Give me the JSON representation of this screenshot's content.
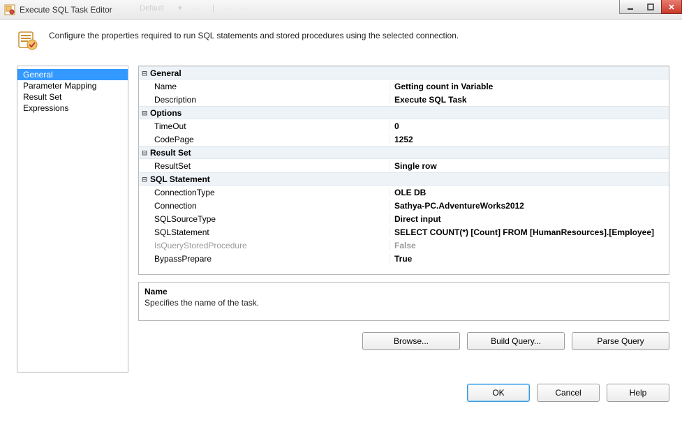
{
  "window": {
    "title": "Execute SQL Task Editor"
  },
  "header": {
    "description": "Configure the properties required to run SQL statements and stored procedures using the selected connection."
  },
  "nav": {
    "items": [
      {
        "label": "General",
        "selected": true
      },
      {
        "label": "Parameter Mapping",
        "selected": false
      },
      {
        "label": "Result Set",
        "selected": false
      },
      {
        "label": "Expressions",
        "selected": false
      }
    ]
  },
  "property_grid": {
    "categories": [
      {
        "name": "General",
        "rows": [
          {
            "key": "Name",
            "value": "Getting count in Variable"
          },
          {
            "key": "Description",
            "value": "Execute SQL Task"
          }
        ]
      },
      {
        "name": "Options",
        "rows": [
          {
            "key": "TimeOut",
            "value": "0"
          },
          {
            "key": "CodePage",
            "value": "1252"
          }
        ]
      },
      {
        "name": "Result Set",
        "rows": [
          {
            "key": "ResultSet",
            "value": "Single row"
          }
        ]
      },
      {
        "name": "SQL Statement",
        "rows": [
          {
            "key": "ConnectionType",
            "value": "OLE DB"
          },
          {
            "key": "Connection",
            "value": "Sathya-PC.AdventureWorks2012"
          },
          {
            "key": "SQLSourceType",
            "value": "Direct input"
          },
          {
            "key": "SQLStatement",
            "value": "SELECT COUNT(*) [Count] FROM [HumanResources].[Employee]"
          },
          {
            "key": "IsQueryStoredProcedure",
            "value": "False",
            "disabled": true
          },
          {
            "key": "BypassPrepare",
            "value": "True"
          }
        ]
      }
    ]
  },
  "description_panel": {
    "title": "Name",
    "body": "Specifies the name of the task."
  },
  "action_buttons": {
    "browse": "Browse...",
    "build_query": "Build Query...",
    "parse_query": "Parse Query"
  },
  "footer_buttons": {
    "ok": "OK",
    "cancel": "Cancel",
    "help": "Help"
  },
  "background_hints": {
    "default": "Default"
  }
}
